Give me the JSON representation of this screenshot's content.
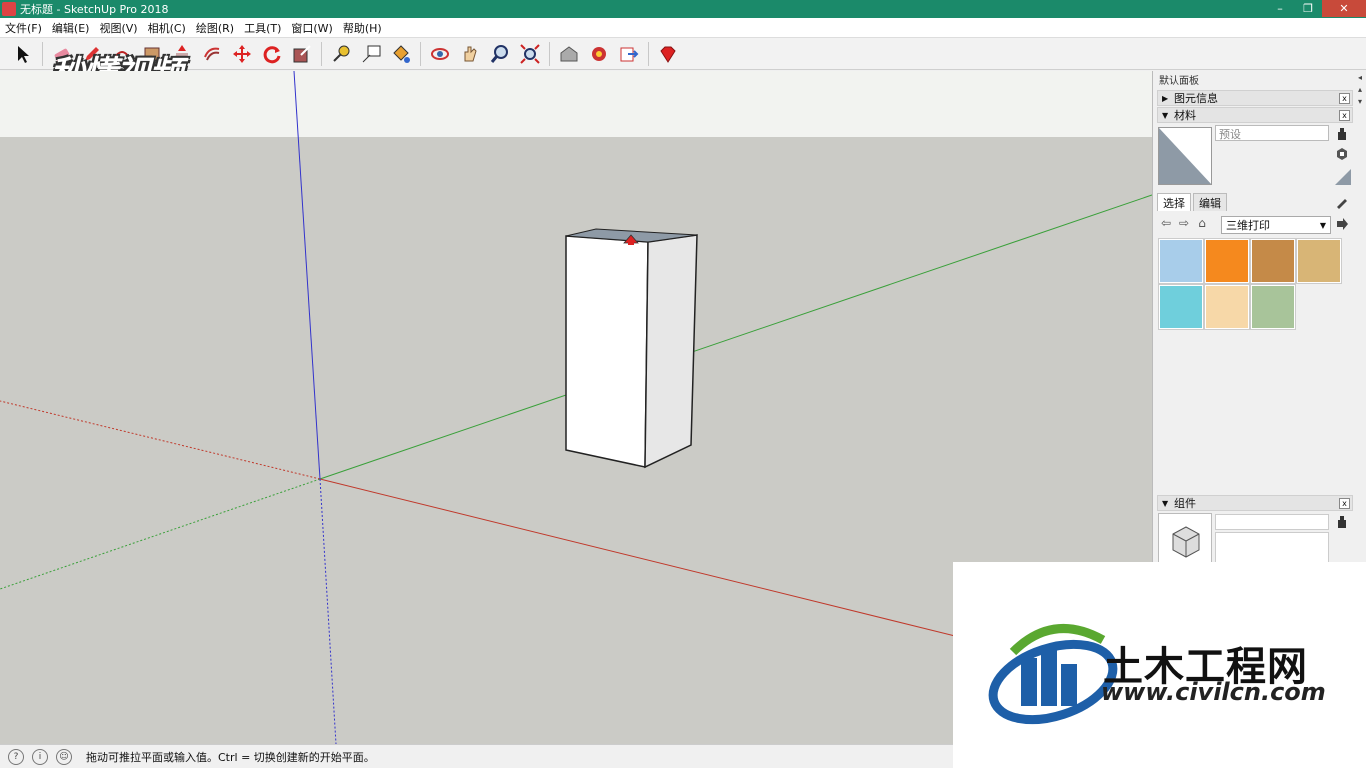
{
  "window": {
    "title": "无标题 - SketchUp Pro 2018",
    "controls": {
      "minimize": "–",
      "maximize": "❐",
      "close": "✕"
    }
  },
  "menu": [
    "文件(F)",
    "编辑(E)",
    "视图(V)",
    "相机(C)",
    "绘图(R)",
    "工具(T)",
    "窗口(W)",
    "帮助(H)"
  ],
  "toolbar": {
    "tools": [
      "select-icon",
      "eraser-icon",
      "pencil-icon",
      "arc-icon",
      "rectangle-icon",
      "push-pull-icon",
      "offset-icon",
      "move-icon",
      "rotate-icon",
      "scale-icon",
      "tape-measure-icon",
      "text-icon",
      "paint-bucket-icon",
      "orbit-icon",
      "pan-icon",
      "zoom-icon",
      "zoom-extents-icon",
      "warehouse-icon",
      "extension-icon",
      "send-layout-icon",
      "ruby-icon"
    ]
  },
  "watermark": {
    "text": "秒懂视频"
  },
  "panel": {
    "header": "默认面板",
    "entity_info": {
      "label": "图元信息",
      "arrow": "▶",
      "close": "x"
    },
    "materials": {
      "label": "材料",
      "arrow": "▼",
      "close": "x",
      "name_placeholder": "预设",
      "tabs": [
        "选择",
        "编辑"
      ],
      "library": "三维打印",
      "nav": {
        "back": "⇦",
        "forward": "⇨",
        "home": "⌂"
      },
      "swatch_colors": [
        "#a8cdea",
        "#f5891e",
        "#c58a48",
        "#d8b576",
        "#6fcfdc",
        "#f7d8a8",
        "#a8c49a"
      ]
    },
    "components": {
      "label": "组件",
      "arrow": "▼",
      "close": "x"
    },
    "side_icons": [
      "◂",
      "▴",
      "▾"
    ]
  },
  "logo": {
    "title": "土木工程网",
    "url": "www.civilcn.com",
    "colors": {
      "blue": "#1e5fa8",
      "green": "#5aa830"
    }
  },
  "status": {
    "icons": [
      "?",
      "i",
      "☺"
    ],
    "text": "拖动可推拉平面或输入值。Ctrl = 切换创建新的开始平面。"
  },
  "colors": {
    "sky": "#f2f3f0",
    "ground": "#cbcbc6",
    "axis_red": "#c0392b",
    "axis_green": "#3aa03a",
    "axis_blue": "#3333cc"
  }
}
